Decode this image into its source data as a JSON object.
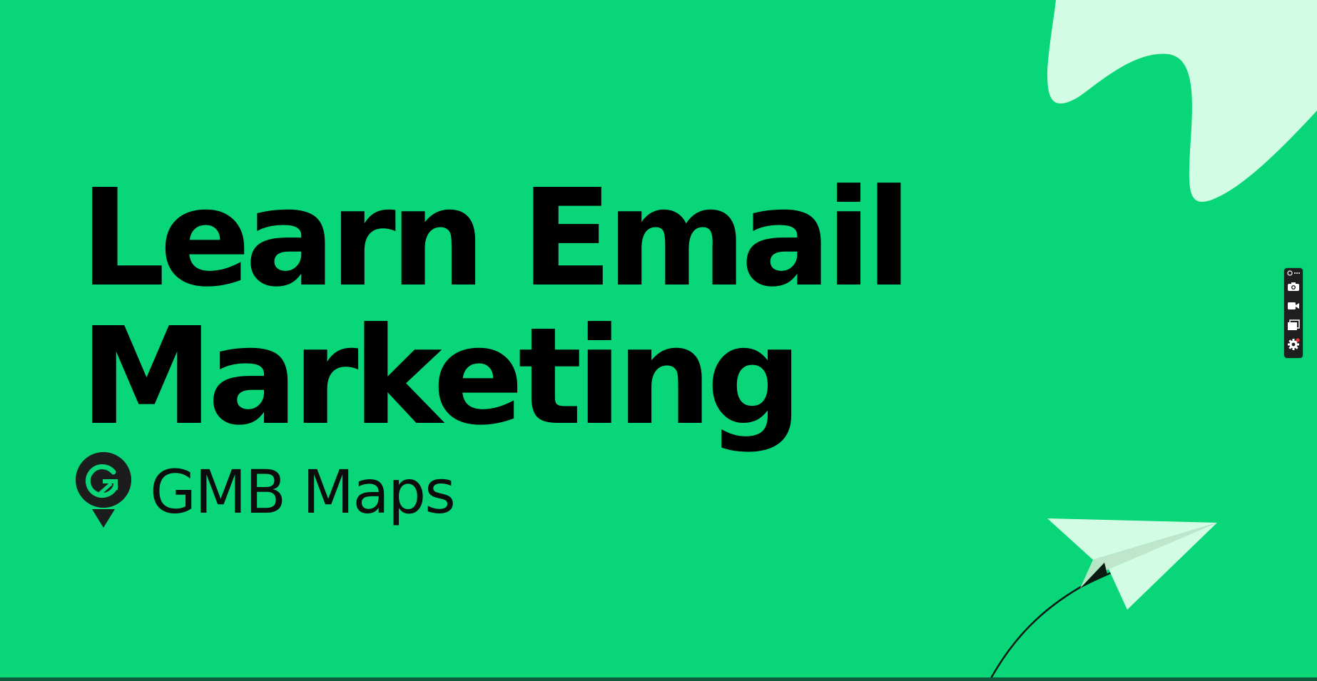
{
  "slide": {
    "headline_line1": "Learn Email",
    "headline_line2": "Marketing",
    "brand_name": "GMB Maps",
    "brand_logo_icon": "gmb-maps-pin-logo",
    "colors": {
      "background": "#08d679",
      "headline": "#000000",
      "accent_light": "#d2fde4",
      "logo": "#1c1c1c",
      "bottom_bar": "#0f5a3a"
    },
    "decorations": [
      "mint-blob-shape",
      "paper-plane-illustration"
    ]
  },
  "capture_toolbar": {
    "buttons": [
      {
        "name": "screenshot",
        "icon": "camera-icon"
      },
      {
        "name": "record-video",
        "icon": "video-camera-icon"
      },
      {
        "name": "capture-window",
        "icon": "window-icon"
      },
      {
        "name": "settings",
        "icon": "gear-icon",
        "has_notification_dot": true
      }
    ],
    "top_icons": [
      "link-icon",
      "more-icon"
    ]
  }
}
